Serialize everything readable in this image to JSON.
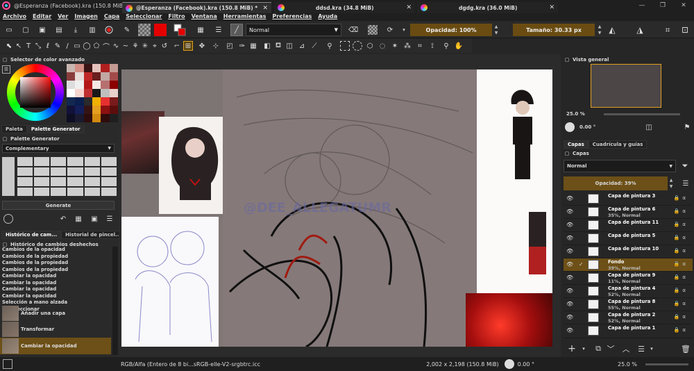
{
  "window": {
    "title": "@Esperanza (Facebook).kra (150.8 MiB) * - Krita",
    "controls": [
      "—",
      "❐",
      "✕"
    ]
  },
  "menu": [
    "Archivo",
    "Editar",
    "Ver",
    "Imagen",
    "Capa",
    "Seleccionar",
    "Filtro",
    "Ventana",
    "Herramientas",
    "Preferencias",
    "Ayuda"
  ],
  "toolbar": {
    "blend_mode": "Normal",
    "opacity": "Opacidad: 100%",
    "size": "Tamaño: 30.33 px"
  },
  "left_dock": {
    "color_selector_title": "Selector de color avanzado",
    "tabs_palette": [
      "Paleta",
      "Palette Generator"
    ],
    "palette_generator_title": "Palette Generator",
    "scheme": "Complementary",
    "generate_button": "Generate",
    "tabs_history": [
      "Histórico de cam...",
      "Historial de pincel..."
    ],
    "history_title": "Histórico de cambios deshechos",
    "history_items": [
      "Cambios de la opacidad",
      "Cambios de la propiedad",
      "Cambios de la propiedad",
      "Cambios de la propiedad",
      "Cambiar la opacidad",
      "Cambiar la opacidad",
      "Cambiar la opacidad",
      "Cambiar la opacidad",
      "Selección a mano alzada",
      "Deseleccionar"
    ],
    "history_thumbs": [
      "Añadir una capa",
      "Transformar",
      "Cambiar la opacidad"
    ]
  },
  "document_tabs": [
    {
      "label": "@Esperanza (Facebook).kra (150.8 MiB) *"
    },
    {
      "label": "ddsd.kra (34.8 MiB)"
    },
    {
      "label": "dgdg.kra (36.0 MiB)"
    }
  ],
  "canvas": {
    "watermark": "@DEE_ALLEGATUMR"
  },
  "right_dock": {
    "overview_title": "Vista general",
    "zoom": "25.0 %",
    "rotation": "0.00 °",
    "tabs": [
      "Capas",
      "Cuadrícula y guías"
    ],
    "layers_title": "Capas",
    "layer_blend": "Normal",
    "layer_opacity": "Opacidad:  39%",
    "layers": [
      {
        "name": "Capa de pintura 3",
        "sub": ""
      },
      {
        "name": "Capa de pintura 6",
        "sub": "35%, Normal"
      },
      {
        "name": "Capa de pintura 11",
        "sub": ""
      },
      {
        "name": "Capa de pintura 5",
        "sub": ""
      },
      {
        "name": "Capa de pintura 10",
        "sub": ""
      },
      {
        "name": "Fondo",
        "sub": "39%, Normal"
      },
      {
        "name": "Capa de pintura 9",
        "sub": "11%, Normal"
      },
      {
        "name": "Capa de pintura 4",
        "sub": "52%, Normal"
      },
      {
        "name": "Capa de pintura 8",
        "sub": "55%, Normal"
      },
      {
        "name": "Capa de pintura 2",
        "sub": "52%, Normal"
      },
      {
        "name": "Capa de pintura 1",
        "sub": ""
      }
    ]
  },
  "status": {
    "profile": "RGB/Alfa (Entero de 8 bi...sRGB-elle-V2-srgbtrc.icc",
    "dimensions": "2,002 x 2,198 (150.8 MiB)",
    "rotation": "0.00 °",
    "zoom": "25.0 %"
  }
}
